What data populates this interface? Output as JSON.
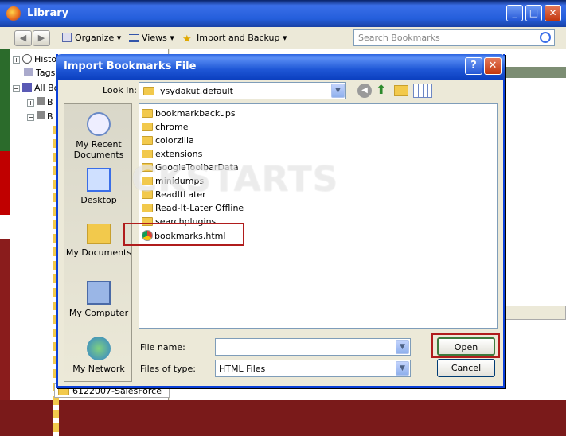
{
  "library": {
    "title": "Library",
    "toolbar": {
      "organize": "Organize",
      "views": "Views",
      "import_backup": "Import and Backup",
      "search_placeholder": "Search Bookmarks"
    },
    "tree": [
      {
        "label": "Histo",
        "expander": "+"
      },
      {
        "label": "Tags",
        "expander": ""
      },
      {
        "label": "All Bo",
        "expander": "−"
      },
      {
        "label": "B",
        "expander": "+"
      },
      {
        "label": "B",
        "expander": "−"
      }
    ],
    "bottom_folder": "6122007-SalesForce"
  },
  "dialog": {
    "title": "Import Bookmarks File",
    "help_label": "?",
    "close_label": "✕",
    "look_in_label": "Look in:",
    "look_in_value": "ysydakut.default",
    "places": [
      {
        "label": "My Recent Documents",
        "icon": "recent-documents-icon"
      },
      {
        "label": "Desktop",
        "icon": "desktop-icon"
      },
      {
        "label": "My Documents",
        "icon": "my-documents-icon"
      },
      {
        "label": "My Computer",
        "icon": "my-computer-icon"
      },
      {
        "label": "My Network",
        "icon": "my-network-icon"
      }
    ],
    "files": [
      {
        "name": "bookmarkbackups",
        "type": "folder"
      },
      {
        "name": "chrome",
        "type": "folder"
      },
      {
        "name": "colorzilla",
        "type": "folder"
      },
      {
        "name": "extensions",
        "type": "folder"
      },
      {
        "name": "GoogleToolbarData",
        "type": "folder"
      },
      {
        "name": "minidumps",
        "type": "folder"
      },
      {
        "name": "ReadItLater",
        "type": "folder"
      },
      {
        "name": "Read-It-Later Offline",
        "type": "folder"
      },
      {
        "name": "searchplugins",
        "type": "folder"
      },
      {
        "name": "bookmarks.html",
        "type": "html"
      }
    ],
    "watermark": "CKSTARTS",
    "file_name_label": "File name:",
    "file_name_value": "",
    "file_type_label": "Files of type:",
    "file_type_value": "HTML Files",
    "open_label": "Open",
    "cancel_label": "Cancel"
  },
  "colors": {
    "highlight": "#b01c1c",
    "xp_blue": "#0a3fd8"
  }
}
